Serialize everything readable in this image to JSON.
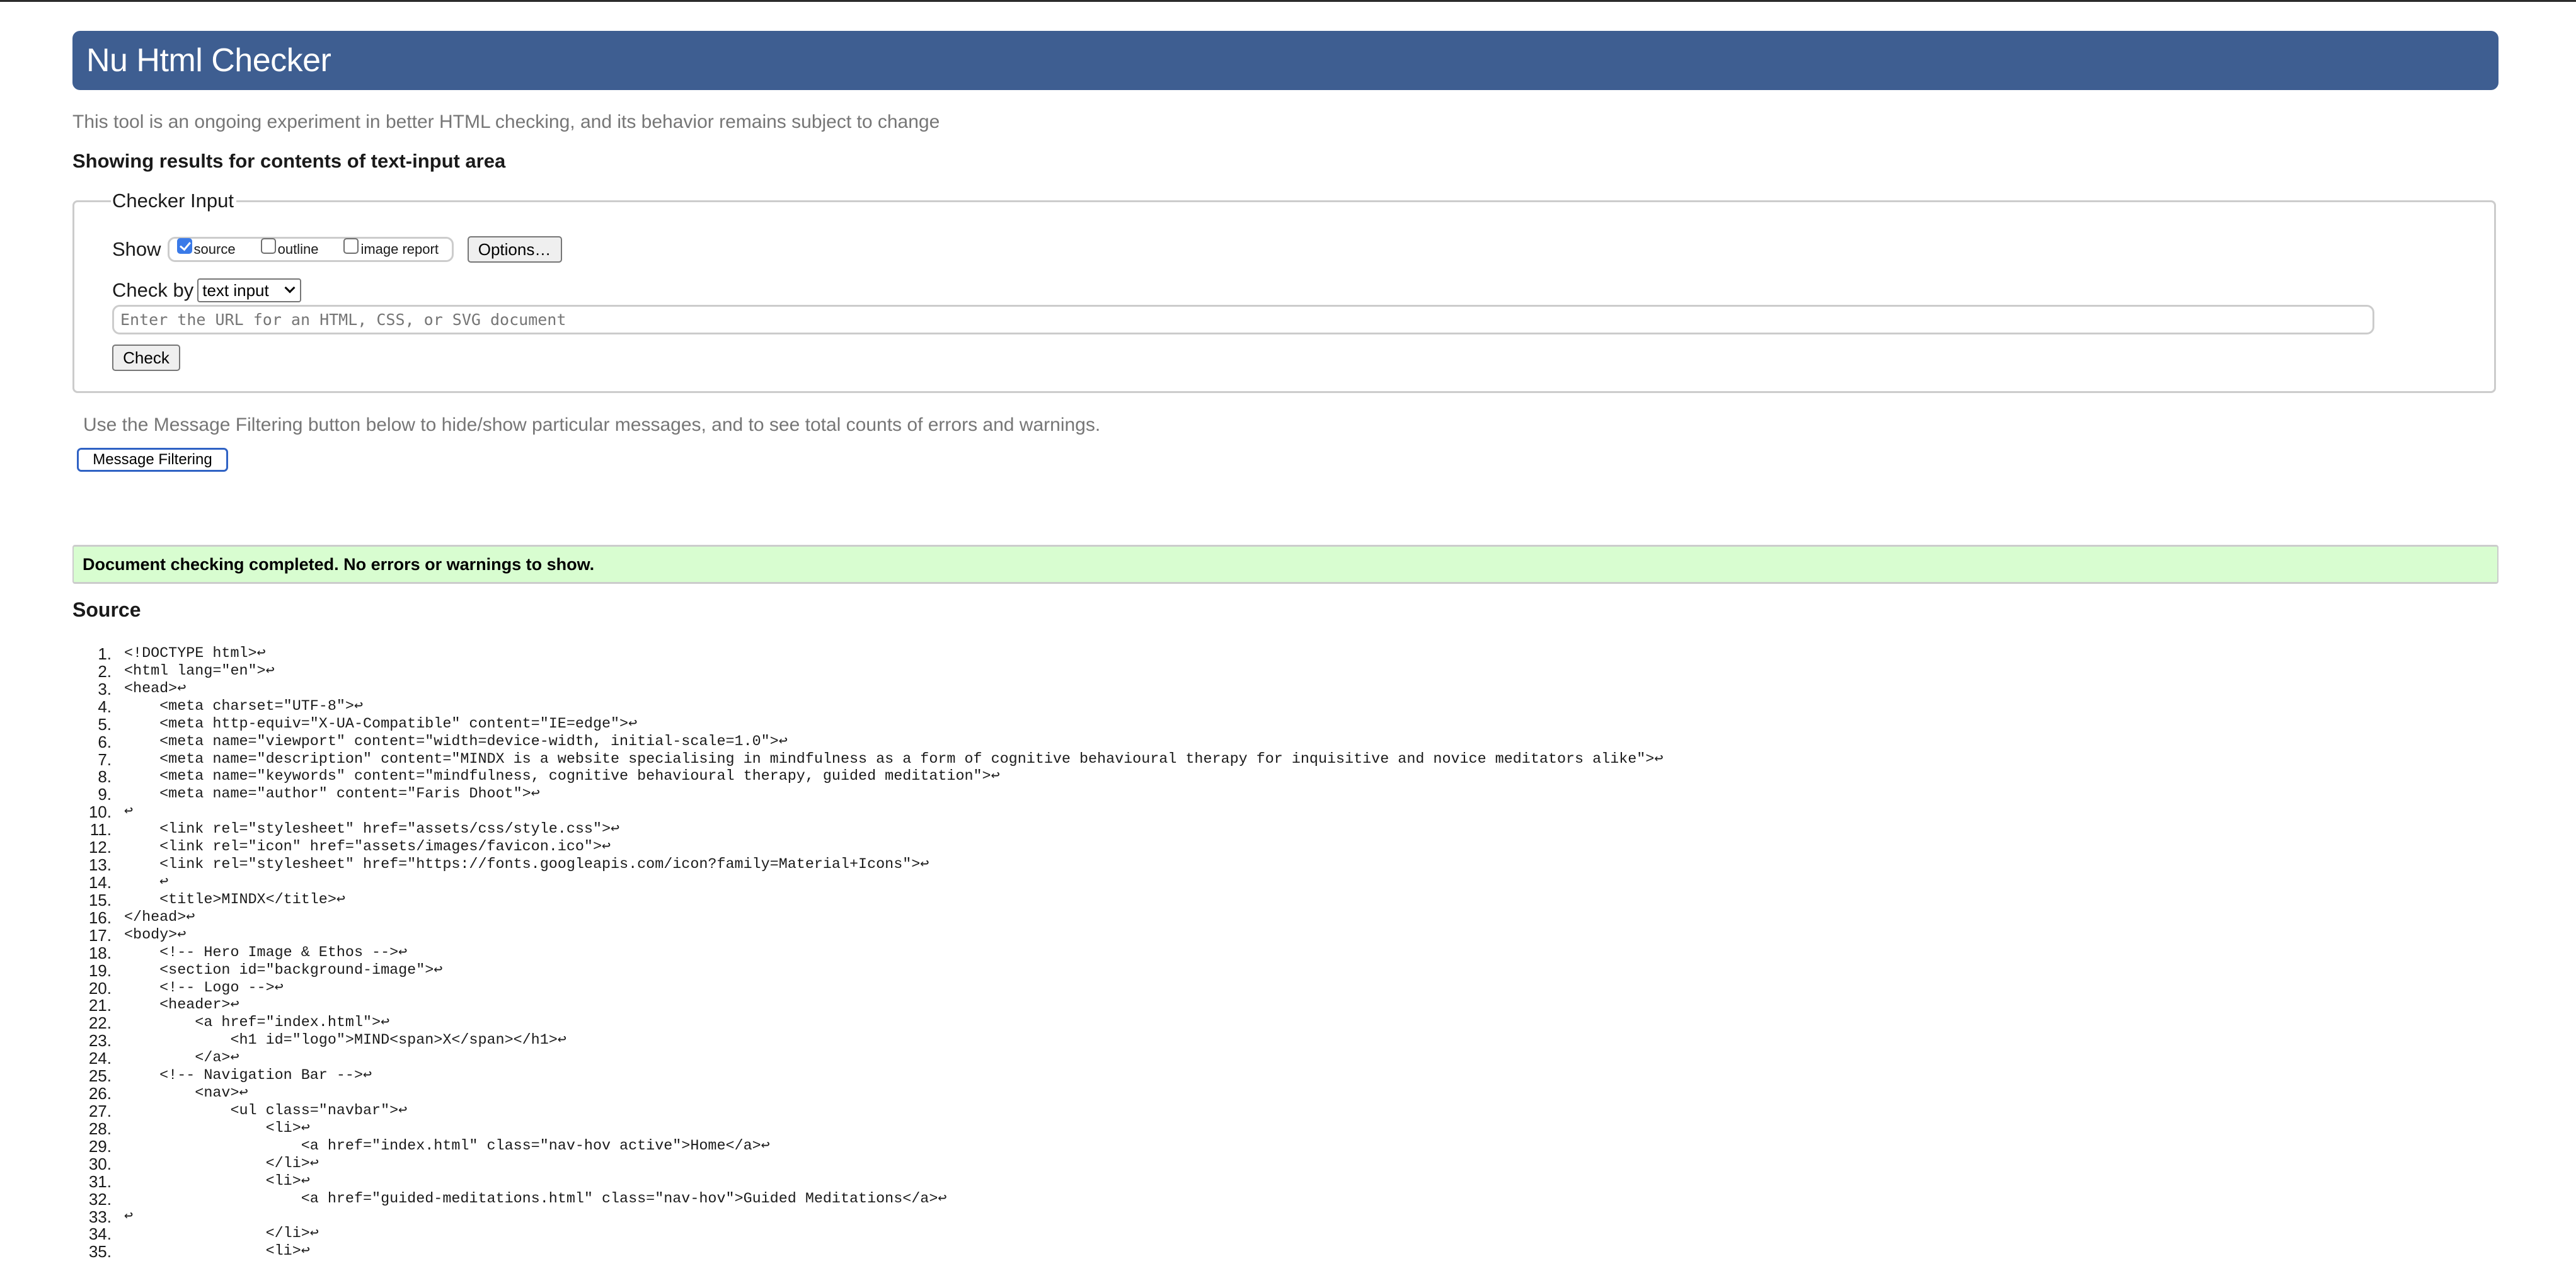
{
  "header": {
    "title": "Nu Html Checker"
  },
  "intro_text": "This tool is an ongoing experiment in better HTML checking, and its behavior remains subject to change",
  "results_heading": "Showing results for contents of text-input area",
  "checker_input": {
    "legend": "Checker Input",
    "show_label": "Show",
    "show_options": [
      {
        "label": "source",
        "checked": true
      },
      {
        "label": "outline",
        "checked": false
      },
      {
        "label": "image report",
        "checked": false
      }
    ],
    "options_button": "Options…",
    "check_by_label": "Check by",
    "check_by_selected": "text input",
    "url_placeholder": "Enter the URL for an HTML, CSS, or SVG document",
    "url_value": "",
    "check_button": "Check"
  },
  "filtering": {
    "note": "Use the Message Filtering button below to hide/show particular messages, and to see total counts of errors and warnings.",
    "button": "Message Filtering"
  },
  "status": {
    "message": "Document checking completed. No errors or warnings to show.",
    "color": "#d8fdd0"
  },
  "source": {
    "heading": "Source",
    "line_end_glyph": "↩",
    "lines": [
      "<!DOCTYPE html>",
      "<html lang=\"en\">",
      "<head>",
      "    <meta charset=\"UTF-8\">",
      "    <meta http-equiv=\"X-UA-Compatible\" content=\"IE=edge\">",
      "    <meta name=\"viewport\" content=\"width=device-width, initial-scale=1.0\">",
      "    <meta name=\"description\" content=\"MINDX is a website specialising in mindfulness as a form of cognitive behavioural therapy for inquisitive and novice meditators alike\">",
      "    <meta name=\"keywords\" content=\"mindfulness, cognitive behavioural therapy, guided meditation\">",
      "    <meta name=\"author\" content=\"Faris Dhoot\">",
      "",
      "    <link rel=\"stylesheet\" href=\"assets/css/style.css\">",
      "    <link rel=\"icon\" href=\"assets/images/favicon.ico\">",
      "    <link rel=\"stylesheet\" href=\"https://fonts.googleapis.com/icon?family=Material+Icons\">",
      "    ",
      "    <title>MINDX</title>",
      "</head>",
      "<body>",
      "    <!-- Hero Image & Ethos -->",
      "    <section id=\"background-image\">",
      "    <!-- Logo -->",
      "    <header>",
      "        <a href=\"index.html\">",
      "            <h1 id=\"logo\">MIND<span>X</span></h1>",
      "        </a>",
      "    <!-- Navigation Bar -->",
      "        <nav>",
      "            <ul class=\"navbar\">",
      "                <li>",
      "                    <a href=\"index.html\" class=\"nav-hov active\">Home</a>",
      "                </li>",
      "                <li>",
      "                    <a href=\"guided-meditations.html\" class=\"nav-hov\">Guided Meditations</a>",
      "",
      "                </li>",
      "                <li>"
    ]
  },
  "colors": {
    "header_bg": "#3e5e91",
    "checkbox_accent": "#3a7ae8",
    "focus_outline": "#2f62c4",
    "muted_text": "#767676"
  }
}
